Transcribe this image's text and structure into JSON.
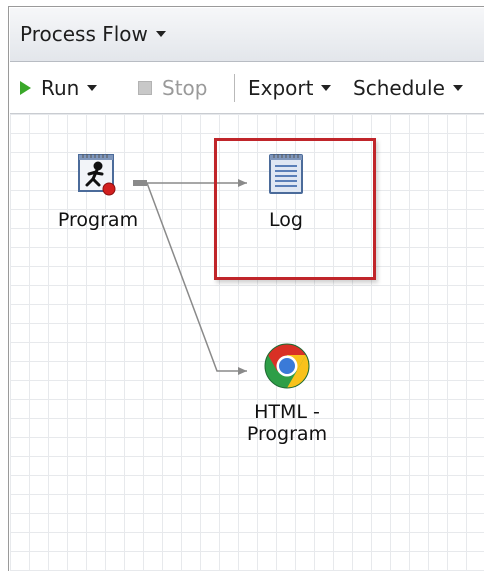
{
  "window": {
    "title": "Process Flow"
  },
  "toolbar": {
    "run_label": "Run",
    "stop_label": "Stop",
    "export_label": "Export",
    "schedule_label": "Schedule"
  },
  "flow": {
    "nodes": [
      {
        "label": "Program",
        "icon": "program-icon"
      },
      {
        "label": "Log",
        "icon": "log-icon"
      },
      {
        "label": "HTML -\nProgram",
        "icon": "chrome-browser-icon"
      }
    ],
    "highlighted_node": "Log"
  },
  "colors": {
    "run_icon": "#3aa82a",
    "highlight_border": "#c0252a",
    "grid": "#e7e9ec",
    "connector": "#8a8a8a"
  }
}
